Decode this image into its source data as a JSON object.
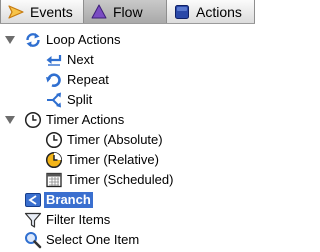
{
  "tabs": [
    {
      "label": "Events",
      "icon": "play-triangle-icon",
      "selected": false
    },
    {
      "label": "Flow",
      "icon": "purple-triangle-icon",
      "selected": true
    },
    {
      "label": "Actions",
      "icon": "blue-square-icon",
      "selected": false
    }
  ],
  "tree": {
    "loop_actions": {
      "label": "Loop Actions",
      "expanded": true,
      "icon": "loop-arrows-icon",
      "children": [
        {
          "label": "Next",
          "icon": "return-arrow-icon"
        },
        {
          "label": "Repeat",
          "icon": "repeat-circle-icon"
        },
        {
          "label": "Split",
          "icon": "split-arrows-icon"
        }
      ]
    },
    "timer_actions": {
      "label": "Timer Actions",
      "expanded": true,
      "icon": "clock-icon",
      "children": [
        {
          "label": "Timer (Absolute)",
          "icon": "clock-icon"
        },
        {
          "label": "Timer (Relative)",
          "icon": "yellow-clock-icon"
        },
        {
          "label": "Timer (Scheduled)",
          "icon": "calendar-icon"
        }
      ]
    },
    "branch": {
      "label": "Branch",
      "icon": "branch-icon",
      "selected": true
    },
    "filter_items": {
      "label": "Filter Items",
      "icon": "funnel-icon"
    },
    "select_one_item": {
      "label": "Select One Item",
      "icon": "magnifier-icon"
    }
  },
  "colors": {
    "selection": "#3a6fcf",
    "loop_blue": "#2f6fd0",
    "clock_yellow": "#f2b418",
    "tab_flow": "#6b3fb0",
    "tab_actions": "#2a48a8",
    "tab_events": "#e8a020"
  }
}
